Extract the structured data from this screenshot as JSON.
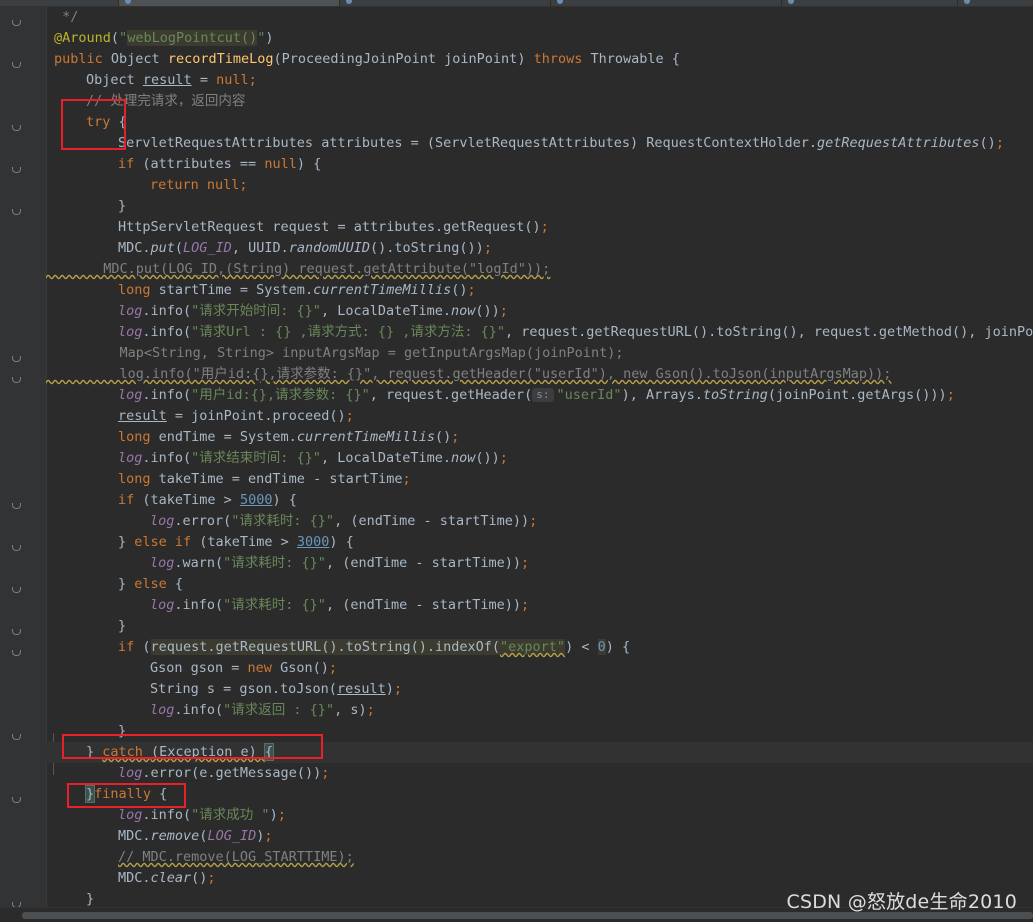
{
  "editor": {
    "background": "#2b2b2b",
    "keyword_color": "#cc7832",
    "string_color": "#6a8759",
    "comment_color": "#808080",
    "number_color": "#6897bb",
    "annotation_color": "#bbb529",
    "highlight_box_color": "#e8202a"
  },
  "lines": [
    {
      "indent": 1,
      "tokens": [
        {
          "t": " */",
          "c": "cmt"
        }
      ]
    },
    {
      "indent": 1,
      "tokens": [
        {
          "t": "@Around",
          "c": "ann"
        },
        {
          "t": "(",
          "c": ""
        },
        {
          "t": "\"",
          "c": "str"
        },
        {
          "t": "webLogPointcut()",
          "c": "str sel-bg"
        },
        {
          "t": "\"",
          "c": "str"
        },
        {
          "t": ")",
          "c": ""
        }
      ]
    },
    {
      "indent": 1,
      "tokens": [
        {
          "t": "public ",
          "c": "kw"
        },
        {
          "t": "Object ",
          "c": ""
        },
        {
          "t": "recordTimeLog",
          "c": "fn"
        },
        {
          "t": "(ProceedingJoinPoint joinPoint) ",
          "c": ""
        },
        {
          "t": "throws ",
          "c": "kw"
        },
        {
          "t": "Throwable {",
          "c": ""
        }
      ]
    },
    {
      "indent": 2,
      "tokens": [
        {
          "t": "Object ",
          "c": ""
        },
        {
          "t": "result",
          "c": "und"
        },
        {
          "t": " = ",
          "c": ""
        },
        {
          "t": "null",
          "c": "kw"
        },
        {
          "t": ";",
          "c": "kw"
        }
      ]
    },
    {
      "indent": 2,
      "tokens": [
        {
          "t": "// 处理完请求，返回内容",
          "c": "cmt"
        }
      ]
    },
    {
      "indent": 2,
      "tokens": [
        {
          "t": "try ",
          "c": "kw"
        },
        {
          "t": "{",
          "c": ""
        }
      ]
    },
    {
      "indent": 3,
      "tokens": [
        {
          "t": "ServletRequestAttributes attributes = (ServletRequestAttributes) RequestContextHolder.",
          "c": ""
        },
        {
          "t": "getRequestAttributes",
          "c": "it"
        },
        {
          "t": "()",
          "c": ""
        },
        {
          "t": ";",
          "c": "kw"
        }
      ]
    },
    {
      "indent": 3,
      "tokens": [
        {
          "t": "if ",
          "c": "kw"
        },
        {
          "t": "(attributes == ",
          "c": ""
        },
        {
          "t": "null",
          "c": "kw"
        },
        {
          "t": ") {",
          "c": ""
        }
      ]
    },
    {
      "indent": 4,
      "tokens": [
        {
          "t": "return null",
          "c": "kw"
        },
        {
          "t": ";",
          "c": "kw"
        }
      ]
    },
    {
      "indent": 3,
      "tokens": [
        {
          "t": "}",
          "c": ""
        }
      ]
    },
    {
      "indent": 3,
      "tokens": [
        {
          "t": "HttpServletRequest request = attributes.getRequest()",
          "c": ""
        },
        {
          "t": ";",
          "c": "kw"
        }
      ]
    },
    {
      "indent": 3,
      "tokens": [
        {
          "t": "MDC.",
          "c": ""
        },
        {
          "t": "put",
          "c": "it"
        },
        {
          "t": "(",
          "c": ""
        },
        {
          "t": "LOG_ID",
          "c": "fld"
        },
        {
          "t": ", UUID.",
          "c": ""
        },
        {
          "t": "randomUUID",
          "c": "it"
        },
        {
          "t": "().toString())",
          "c": ""
        },
        {
          "t": ";",
          "c": "kw"
        }
      ]
    },
    {
      "indent": 0,
      "tokens": [
        {
          "t": "//        MDC.put(LOG_ID,(String) request.getAttribute(\"logId\"));",
          "c": "cmt wavy"
        }
      ]
    },
    {
      "indent": 3,
      "tokens": [
        {
          "t": "long ",
          "c": "kw"
        },
        {
          "t": "startTime = System.",
          "c": ""
        },
        {
          "t": "currentTimeMillis",
          "c": "it"
        },
        {
          "t": "()",
          "c": ""
        },
        {
          "t": ";",
          "c": "kw"
        }
      ]
    },
    {
      "indent": 3,
      "tokens": [
        {
          "t": "log",
          "c": "fld"
        },
        {
          "t": ".info(",
          "c": ""
        },
        {
          "t": "\"请求开始时间: {}\"",
          "c": "str"
        },
        {
          "t": ", LocalDateTime.",
          "c": ""
        },
        {
          "t": "now",
          "c": "it"
        },
        {
          "t": "())",
          "c": ""
        },
        {
          "t": ";",
          "c": "kw"
        }
      ]
    },
    {
      "indent": 3,
      "tokens": [
        {
          "t": "log",
          "c": "fld"
        },
        {
          "t": ".info(",
          "c": ""
        },
        {
          "t": "\"请求Url : {} ,请求方式: {} ,请求方法: {}\"",
          "c": "str"
        },
        {
          "t": ", request.getRequestURL().toString(), request.getMethod(), joinPoint",
          "c": ""
        }
      ]
    },
    {
      "indent": 0,
      "tokens": [
        {
          "t": "//          Map<String, String> inputArgsMap = getInputArgsMap(joinPoint);",
          "c": "cmt"
        }
      ]
    },
    {
      "indent": 0,
      "tokens": [
        {
          "t": "//          log.info(\"用户id:{},请求参数: {}\", request.getHeader(\"userId\"), new Gson().toJson(inputArgsMap));",
          "c": "cmt wavy"
        }
      ]
    },
    {
      "indent": 3,
      "tokens": [
        {
          "t": "log",
          "c": "fld"
        },
        {
          "t": ".info(",
          "c": ""
        },
        {
          "t": "\"用户id:{},请求参数: {}\"",
          "c": "str"
        },
        {
          "t": ", request.getHeader(",
          "c": ""
        },
        {
          "t": "s:",
          "c": "hint"
        },
        {
          "t": "\"userId\"",
          "c": "str"
        },
        {
          "t": "), Arrays.",
          "c": ""
        },
        {
          "t": "toString",
          "c": "it"
        },
        {
          "t": "(joinPoint.getArgs()))",
          "c": ""
        },
        {
          "t": ";",
          "c": "kw"
        }
      ]
    },
    {
      "indent": 3,
      "tokens": [
        {
          "t": "result",
          "c": "und"
        },
        {
          "t": " = joinPoint.proceed()",
          "c": ""
        },
        {
          "t": ";",
          "c": "kw"
        }
      ]
    },
    {
      "indent": 3,
      "tokens": [
        {
          "t": "long ",
          "c": "kw"
        },
        {
          "t": "endTime = System.",
          "c": ""
        },
        {
          "t": "currentTimeMillis",
          "c": "it"
        },
        {
          "t": "()",
          "c": ""
        },
        {
          "t": ";",
          "c": "kw"
        }
      ]
    },
    {
      "indent": 3,
      "tokens": [
        {
          "t": "log",
          "c": "fld"
        },
        {
          "t": ".info(",
          "c": ""
        },
        {
          "t": "\"请求结束时间: {}\"",
          "c": "str"
        },
        {
          "t": ", LocalDateTime.",
          "c": ""
        },
        {
          "t": "now",
          "c": "it"
        },
        {
          "t": "())",
          "c": ""
        },
        {
          "t": ";",
          "c": "kw"
        }
      ]
    },
    {
      "indent": 3,
      "tokens": [
        {
          "t": "long ",
          "c": "kw"
        },
        {
          "t": "takeTime = endTime - startTime",
          "c": ""
        },
        {
          "t": ";",
          "c": "kw"
        }
      ]
    },
    {
      "indent": 3,
      "tokens": [
        {
          "t": "if ",
          "c": "kw"
        },
        {
          "t": "(takeTime > ",
          "c": ""
        },
        {
          "t": "5000",
          "c": "num und"
        },
        {
          "t": ") {",
          "c": ""
        }
      ]
    },
    {
      "indent": 4,
      "tokens": [
        {
          "t": "log",
          "c": "fld"
        },
        {
          "t": ".error(",
          "c": ""
        },
        {
          "t": "\"请求耗时: {}\"",
          "c": "str"
        },
        {
          "t": ", (endTime - startTime))",
          "c": ""
        },
        {
          "t": ";",
          "c": "kw"
        }
      ]
    },
    {
      "indent": 3,
      "tokens": [
        {
          "t": "} ",
          "c": ""
        },
        {
          "t": "else if ",
          "c": "kw"
        },
        {
          "t": "(takeTime > ",
          "c": ""
        },
        {
          "t": "3000",
          "c": "num und"
        },
        {
          "t": ") {",
          "c": ""
        }
      ]
    },
    {
      "indent": 4,
      "tokens": [
        {
          "t": "log",
          "c": "fld"
        },
        {
          "t": ".warn(",
          "c": ""
        },
        {
          "t": "\"请求耗时: {}\"",
          "c": "str"
        },
        {
          "t": ", (endTime - startTime))",
          "c": ""
        },
        {
          "t": ";",
          "c": "kw"
        }
      ]
    },
    {
      "indent": 3,
      "tokens": [
        {
          "t": "} ",
          "c": ""
        },
        {
          "t": "else ",
          "c": "kw"
        },
        {
          "t": "{",
          "c": ""
        }
      ]
    },
    {
      "indent": 4,
      "tokens": [
        {
          "t": "log",
          "c": "fld"
        },
        {
          "t": ".info(",
          "c": ""
        },
        {
          "t": "\"请求耗时: {}\"",
          "c": "str"
        },
        {
          "t": ", (endTime - startTime))",
          "c": ""
        },
        {
          "t": ";",
          "c": "kw"
        }
      ]
    },
    {
      "indent": 3,
      "tokens": [
        {
          "t": "}",
          "c": ""
        }
      ]
    },
    {
      "indent": 3,
      "tokens": [
        {
          "t": "if ",
          "c": "kw"
        },
        {
          "t": "(",
          "c": ""
        },
        {
          "t": "request.getRequestURL().toString().indexOf(",
          "c": "sel-bg"
        },
        {
          "t": "\"export\"",
          "c": "str sel-bg wavy"
        },
        {
          "t": ") < ",
          "c": ""
        },
        {
          "t": "0",
          "c": "num sel-bg"
        },
        {
          "t": ") {",
          "c": ""
        }
      ]
    },
    {
      "indent": 4,
      "tokens": [
        {
          "t": "Gson gson = ",
          "c": ""
        },
        {
          "t": "new ",
          "c": "kw"
        },
        {
          "t": "Gson()",
          "c": ""
        },
        {
          "t": ";",
          "c": "kw"
        }
      ]
    },
    {
      "indent": 4,
      "tokens": [
        {
          "t": "String s = gson.toJson(",
          "c": ""
        },
        {
          "t": "result",
          "c": "und"
        },
        {
          "t": ")",
          "c": ""
        },
        {
          "t": ";",
          "c": "kw"
        }
      ]
    },
    {
      "indent": 4,
      "tokens": [
        {
          "t": "log",
          "c": "fld"
        },
        {
          "t": ".info(",
          "c": ""
        },
        {
          "t": "\"请求返回 : {}\"",
          "c": "str"
        },
        {
          "t": ", s)",
          "c": ""
        },
        {
          "t": ";",
          "c": "kw"
        }
      ]
    },
    {
      "indent": 3,
      "tokens": [
        {
          "t": "}",
          "c": ""
        }
      ]
    },
    {
      "indent": 2,
      "hl": true,
      "tokens": [
        {
          "t": "} ",
          "c": ""
        },
        {
          "t": "catch ",
          "c": "kw wavy"
        },
        {
          "t": "(Exception e) ",
          "c": "wavy"
        },
        {
          "t": "{",
          "c": "brace-hl"
        }
      ]
    },
    {
      "indent": 3,
      "tokens": [
        {
          "t": "log",
          "c": "fld"
        },
        {
          "t": ".error(e.getMessage())",
          "c": ""
        },
        {
          "t": ";",
          "c": "kw"
        }
      ]
    },
    {
      "indent": 2,
      "tokens": [
        {
          "t": "}",
          "c": "brace-hl"
        },
        {
          "t": "finally ",
          "c": "kw"
        },
        {
          "t": "{",
          "c": ""
        }
      ]
    },
    {
      "indent": 3,
      "tokens": [
        {
          "t": "log",
          "c": "fld"
        },
        {
          "t": ".info(",
          "c": ""
        },
        {
          "t": "\"请求成功 \"",
          "c": "str"
        },
        {
          "t": ")",
          "c": ""
        },
        {
          "t": ";",
          "c": "kw"
        }
      ]
    },
    {
      "indent": 3,
      "tokens": [
        {
          "t": "MDC.",
          "c": ""
        },
        {
          "t": "remove",
          "c": "it"
        },
        {
          "t": "(",
          "c": ""
        },
        {
          "t": "LOG_ID",
          "c": "fld"
        },
        {
          "t": ")",
          "c": ""
        },
        {
          "t": ";",
          "c": "kw"
        }
      ]
    },
    {
      "indent": 3,
      "tokens": [
        {
          "t": "// MDC.remove(LOG_STARTTIME);",
          "c": "cmt wavy"
        }
      ]
    },
    {
      "indent": 3,
      "tokens": [
        {
          "t": "MDC.",
          "c": ""
        },
        {
          "t": "clear",
          "c": "it"
        },
        {
          "t": "()",
          "c": ""
        },
        {
          "t": ";",
          "c": "kw"
        }
      ]
    },
    {
      "indent": 2,
      "tokens": [
        {
          "t": "}",
          "c": ""
        }
      ]
    }
  ],
  "watermark": "CSDN @怒放de生命2010"
}
